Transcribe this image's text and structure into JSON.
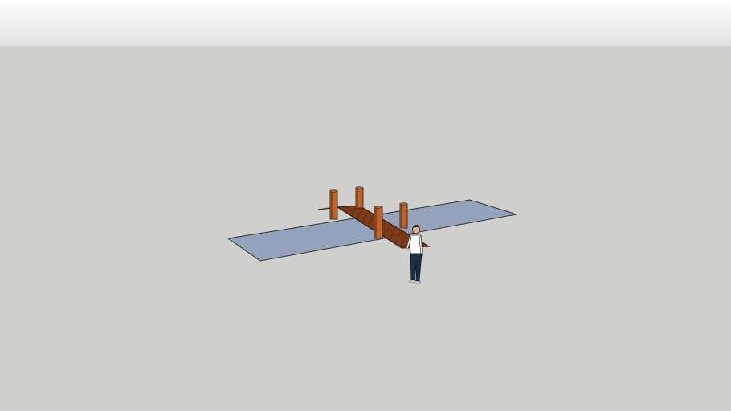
{
  "viewport": {
    "sky_color": "#f4f4f5",
    "horizon_color": "#e1e1e3",
    "ground_color": "#cfcfcd"
  },
  "model": {
    "objects": [
      "water-surface",
      "dock-ramp",
      "piling-back-left",
      "piling-back-middle",
      "piling-front",
      "piling-back-right",
      "scale-figure-person"
    ],
    "colors": {
      "water": "#94a3bb",
      "deck": "#7a3b16",
      "piling": "#c0632b",
      "piling_shadow": "#8f431a",
      "edge": "#333333",
      "person_shirt": "#ffffff",
      "person_pants": "#1f2d4a",
      "person_hair": "#111111",
      "person_skin": "#e0b08a"
    }
  }
}
